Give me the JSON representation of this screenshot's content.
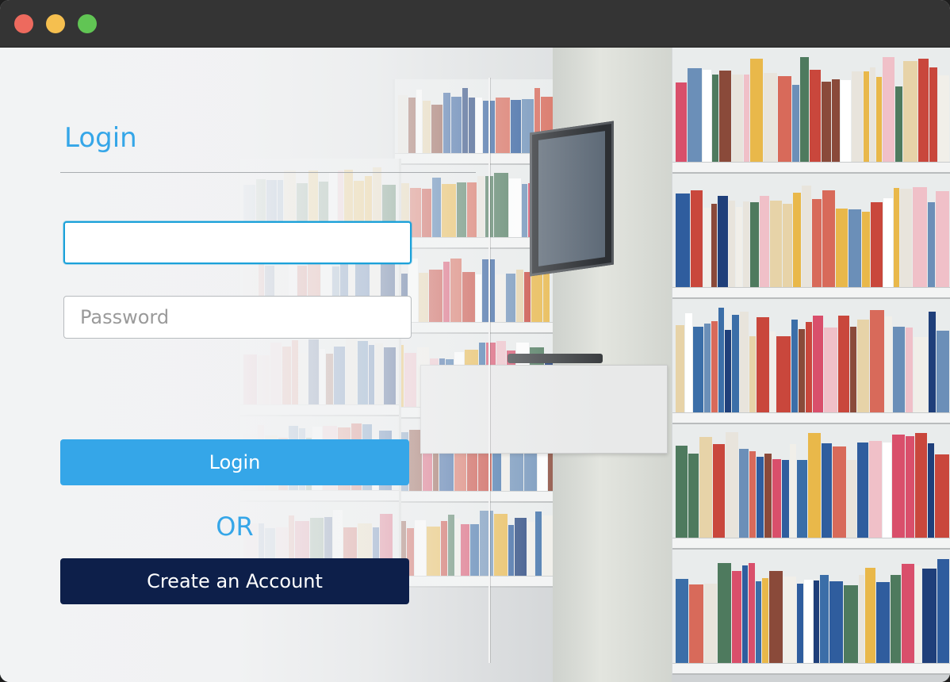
{
  "window": {
    "controls": [
      "close",
      "minimize",
      "zoom"
    ]
  },
  "login_form": {
    "title": "Login",
    "username_value": "",
    "username_placeholder": "",
    "password_placeholder": "Password",
    "login_button": "Login",
    "or_text": "OR",
    "create_account_button": "Create an Account"
  },
  "colors": {
    "accent": "#35a6e8",
    "create_button": "#0d1f4a",
    "focus_border": "#1ba1d9"
  },
  "background": {
    "description_icon": "library-bookshelves-photo"
  }
}
